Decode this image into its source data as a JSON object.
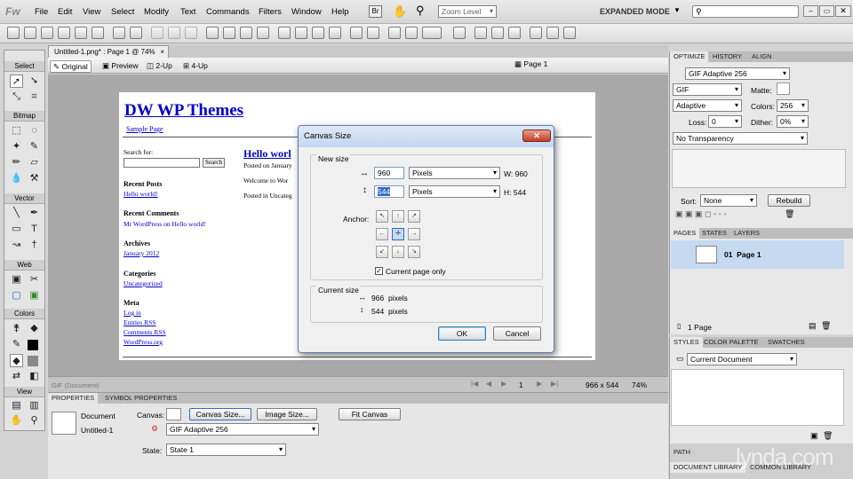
{
  "app": {
    "logo": "Fw",
    "logo_br": "Br",
    "zoom_label": "Zoom Level",
    "mode": "EXPANDED MODE"
  },
  "menu": [
    "File",
    "Edit",
    "View",
    "Select",
    "Modify",
    "Text",
    "Commands",
    "Filters",
    "Window",
    "Help"
  ],
  "doc_tab": {
    "title": "Untitled-1.png* : Page 1 @ 74%"
  },
  "view_tabs": {
    "original": "Original",
    "preview": "Preview",
    "two_up": "2-Up",
    "four_up": "4-Up",
    "page": "Page 1"
  },
  "tools": {
    "select": "Select",
    "bitmap": "Bitmap",
    "vector": "Vector",
    "web": "Web",
    "colors": "Colors",
    "view": "View"
  },
  "website": {
    "title": "DW WP Themes",
    "nav": "Sample Page",
    "search_label": "Search for:",
    "search_button": "Search",
    "recent_posts_title": "Recent Posts",
    "recent_posts_item": "Hello world!",
    "recent_comments_title": "Recent Comments",
    "recent_comments_item": "Mr WordPress on Hello world!",
    "archives_title": "Archives",
    "archives_item": "January 2012",
    "categories_title": "Categories",
    "categories_item": "Uncategorized",
    "meta_title": "Meta",
    "meta_items": [
      "Log in",
      "Entries RSS",
      "Comments RSS",
      "WordPress.org"
    ],
    "post_title": "Hello worl",
    "post_date": "Posted on January",
    "post_body": "Welcome to Wor",
    "post_category": "Posted in Uncateg"
  },
  "dialog": {
    "title": "Canvas Size",
    "new_size_label": "New size",
    "width_value": "960",
    "height_value": "544",
    "width_unit": "Pixels",
    "height_unit": "Pixels",
    "width_readout": "W: 960",
    "height_readout": "H: 544",
    "anchor_label": "Anchor:",
    "current_page_only": "Current page only",
    "current_size_label": "Current size",
    "current_width": "966",
    "current_height": "544",
    "pixels": "pixels",
    "ok": "OK",
    "cancel": "Cancel"
  },
  "status": {
    "doc_label": "GIF (Document)",
    "page_num": "1",
    "dimensions": "966 x 544",
    "zoom": "74%"
  },
  "properties": {
    "tab_props": "PROPERTIES",
    "tab_symbol": "SYMBOL PROPERTIES",
    "doc_name": "Document",
    "doc_file": "Untitled-1",
    "canvas_label": "Canvas:",
    "canvas_size_btn": "Canvas Size...",
    "image_size_btn": "Image Size...",
    "fit_canvas_btn": "Fit Canvas",
    "optimize_select": "GIF Adaptive 256",
    "state_label": "State:",
    "state_value": "State 1"
  },
  "optimize": {
    "tabs": [
      "OPTIMIZE",
      "HISTORY",
      "ALIGN"
    ],
    "preset": "GIF Adaptive 256",
    "format": "GIF",
    "matte_label": "Matte:",
    "palette": "Adaptive",
    "colors_label": "Colors:",
    "colors_value": "256",
    "loss_label": "Loss:",
    "loss_value": "0",
    "dither_label": "Dither:",
    "dither_value": "0%",
    "transparency": "No Transparency",
    "sort_label": "Sort:",
    "sort_value": "None",
    "rebuild": "Rebuild"
  },
  "pages": {
    "tabs": [
      "PAGES",
      "STATES",
      "LAYERS"
    ],
    "page_item": "01  Page 1",
    "count": "1 Page"
  },
  "styles": {
    "tabs": [
      "STYLES",
      "COLOR PALETTE",
      "SWATCHES"
    ],
    "select": "Current Document"
  },
  "bottom_tabs": {
    "path": "PATH",
    "doc_library": "DOCUMENT LIBRARY",
    "common_library": "COMMON LIBRARY",
    "watermark": "lynda.com"
  },
  "colors": {
    "accent": "#316ac5",
    "selected_page": "#c5d9f1",
    "link": "#0000cc"
  }
}
